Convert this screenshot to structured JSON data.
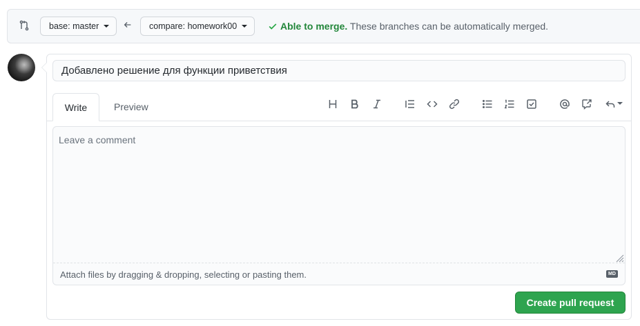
{
  "compare_bar": {
    "base_prefix": "base:",
    "base_branch": "master",
    "compare_prefix": "compare:",
    "compare_branch": "homework00",
    "merge_ok": "Able to merge.",
    "merge_message": "These branches can be automatically merged."
  },
  "pr_form": {
    "title_value": "Добавлено решение для функции приветствия",
    "tabs": [
      {
        "label": "Write",
        "active": true
      },
      {
        "label": "Preview",
        "active": false
      }
    ],
    "toolbar": [
      "heading-icon",
      "bold-icon",
      "italic-icon",
      "quote-icon",
      "code-icon",
      "link-icon",
      "unordered-list-icon",
      "ordered-list-icon",
      "task-list-icon",
      "mention-icon",
      "cross-reference-icon",
      "reply-icon"
    ],
    "comment_placeholder": "Leave a comment",
    "attach_text": "Attach files by dragging & dropping, selecting or pasting them.",
    "markdown_badge": "MD",
    "submit_label": "Create pull request"
  },
  "colors": {
    "success": "#2ea44f",
    "merge_ok_text": "#22863a",
    "muted": "#586069"
  }
}
